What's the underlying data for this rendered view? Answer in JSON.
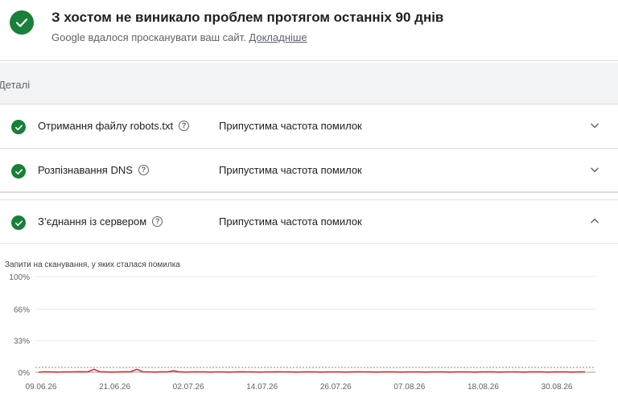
{
  "header": {
    "title": "З хостом не виникало проблем протягом останніх 90 днів",
    "subtitle": "Google вдалося просканувати ваш сайт.",
    "link": "Докладніше"
  },
  "details": {
    "label": "Деталі"
  },
  "rows": [
    {
      "name": "Отримання файлу robots.txt",
      "status": "Припустима частота помилок",
      "expanded": false
    },
    {
      "name": "Розпізнавання DNS",
      "status": "Припустима частота помилок",
      "expanded": false
    },
    {
      "name": "З’єднання із сервером",
      "status": "Припустима частота помилок",
      "expanded": true
    }
  ],
  "colors": {
    "ok": "#188038",
    "line": "#d93025",
    "threshold": "#e57373"
  },
  "icons": {
    "status": "check-circle-icon",
    "help": "help-circle-icon",
    "expand": "chevron-down-icon",
    "collapse": "chevron-up-icon"
  },
  "chart_data": {
    "type": "line",
    "title": "Запити на сканування, у яких сталася помилка",
    "y_ticks": [
      "100%",
      "66%",
      "33%",
      "0%"
    ],
    "x_ticks": [
      "09.06.26",
      "21.06.26",
      "02.07.26",
      "14.07.26",
      "26.07.26",
      "07.08.26",
      "18.08.26",
      "30.08.26"
    ],
    "ylim": [
      0,
      100
    ],
    "threshold": 5,
    "series": [
      {
        "values": [
          0,
          0.5,
          0.3,
          0.2,
          0.4,
          0.3,
          0.5,
          0.6,
          0.4,
          3,
          0.5,
          0.3,
          0.2,
          0.3,
          0.5,
          0.6,
          3,
          0.4,
          0.3,
          0.2,
          0.5,
          0.4,
          1.5,
          0.3,
          0.2,
          0.3,
          0.4,
          0.3,
          0.2,
          0.4,
          0.3,
          0.2,
          0.3,
          0.5,
          0.4,
          0.3,
          0.2,
          0.4,
          0.3,
          0.5,
          0.4,
          0.3,
          0.2,
          0.3,
          0.4,
          0.3,
          0.2,
          0.3,
          0.4,
          0.3,
          0.2,
          0.3,
          0.5,
          0.4,
          0.3,
          0.2,
          0.3,
          0.4,
          0.3,
          0.2,
          0.3,
          0.4,
          0.3,
          0.2,
          0.3,
          0.4,
          0.3,
          0.2,
          0.3,
          0.4,
          0.3,
          0.2,
          0.3,
          0.4,
          0.3,
          0.2,
          0.3,
          0.4,
          0.3,
          0.2,
          0.3,
          0.4,
          0.3,
          0.2,
          0.3,
          0.4,
          0.3,
          0.2,
          0.3,
          0.4
        ]
      }
    ]
  }
}
